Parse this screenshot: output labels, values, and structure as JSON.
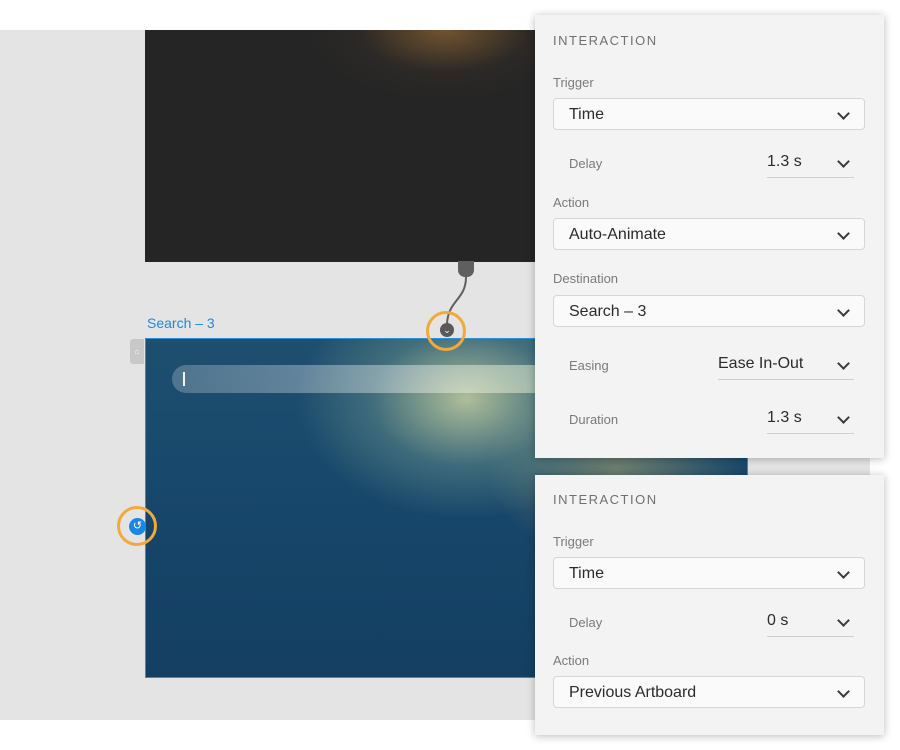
{
  "canvas": {
    "destination_artboard_name": "Search – 3"
  },
  "interaction_panel_1": {
    "title": "INTERACTION",
    "trigger": {
      "label": "Trigger",
      "value": "Time"
    },
    "delay": {
      "label": "Delay",
      "value": "1.3 s"
    },
    "action": {
      "label": "Action",
      "value": "Auto-Animate"
    },
    "destination": {
      "label": "Destination",
      "value": "Search – 3"
    },
    "easing": {
      "label": "Easing",
      "value": "Ease In-Out"
    },
    "duration": {
      "label": "Duration",
      "value": "1.3 s"
    }
  },
  "interaction_panel_2": {
    "title": "INTERACTION",
    "trigger": {
      "label": "Trigger",
      "value": "Time"
    },
    "delay": {
      "label": "Delay",
      "value": "0 s"
    },
    "action": {
      "label": "Action",
      "value": "Previous Artboard"
    }
  },
  "colors": {
    "highlight_ring": "#f2a93b",
    "selection_blue": "#2d8fd8",
    "panel_bg": "#f3f3f3"
  },
  "icons": [
    "home-icon",
    "chevron-down-icon",
    "back-arrow-icon",
    "wire-connector-icon"
  ]
}
